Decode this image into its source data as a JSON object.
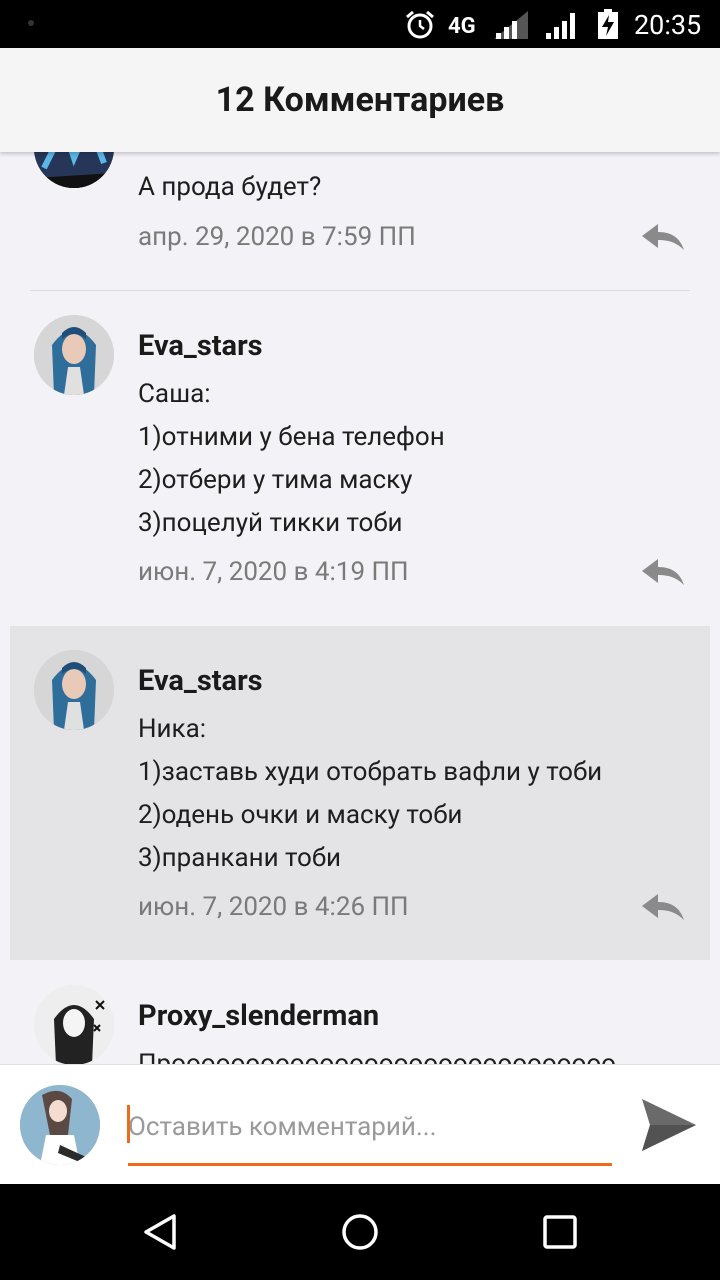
{
  "status_bar": {
    "network": "4G",
    "time": "20:35"
  },
  "header": {
    "title": "12 Комментариев"
  },
  "comments": [
    {
      "author": "_",
      "lines": [
        "А прода будет?"
      ],
      "date": "апр. 29, 2020 в 7:59 ПП"
    },
    {
      "author": "Eva_stars",
      "lines": [
        "Саша:",
        "1)отними у бена телефон",
        "2)отбери у тима маску",
        "3)поцелуй тикки тоби"
      ],
      "date": "июн. 7, 2020 в 4:19 ПП"
    },
    {
      "author": "Eva_stars",
      "lines": [
        "Ника:",
        "1)заставь худи отобрать вафли у тоби",
        "2)одень очки и маску тоби",
        "3)пранкани тоби"
      ],
      "date": "июн. 7, 2020 в 4:26 ПП"
    },
    {
      "author": "Proxy_slenderman",
      "lines": [
        "Пpoooooooooooooooooooooooooooooo"
      ],
      "date": ""
    }
  ],
  "input": {
    "placeholder": "Оставить комментарий...",
    "value": ""
  },
  "colors": {
    "accent": "#ee6a1f",
    "highlight_bg": "#e4e3e6",
    "bg": "#f3f2f7",
    "date_text": "#7a7a7a"
  },
  "icons": {
    "alarm": "alarm-clock-icon",
    "signal": "cell-signal-icon",
    "battery": "battery-charging-icon",
    "reply": "reply-arrow-icon",
    "send": "send-icon",
    "back": "nav-back-icon",
    "home": "nav-home-icon",
    "recent": "nav-recent-apps-icon"
  }
}
